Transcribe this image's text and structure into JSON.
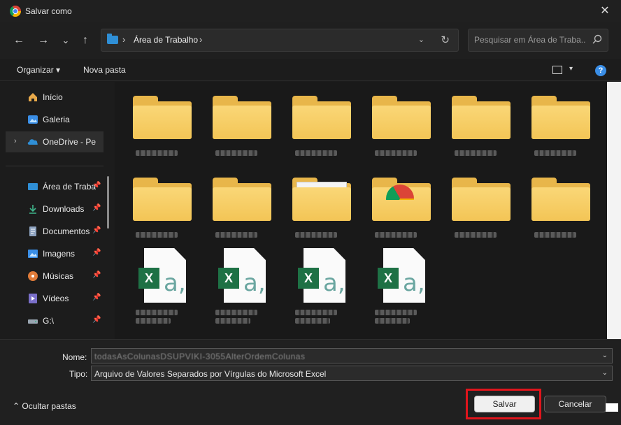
{
  "window": {
    "title": "Salvar como",
    "close": "✕"
  },
  "nav": {
    "back": "←",
    "forward": "→",
    "recent": "⌄",
    "up": "↑",
    "address": {
      "path": "Área de Trabalho",
      "sep": "›",
      "dropdown": "⌄",
      "refresh": "↻"
    },
    "search": {
      "placeholder": "Pesquisar em Área de Traba..."
    }
  },
  "toolbar": {
    "organize": "Organizar ▾",
    "new_folder": "Nova pasta",
    "view_dd": "▾",
    "help": "?"
  },
  "sidebar": {
    "items": [
      {
        "label": "Início",
        "icon": "home-icon"
      },
      {
        "label": "Galeria",
        "icon": "gallery-icon"
      },
      {
        "label": "OneDrive - Pessoal",
        "icon": "onedrive-icon",
        "chevron": "›",
        "selected": true
      },
      {
        "label": "Área de Trabalho",
        "icon": "desktop-icon",
        "pin": "📌"
      },
      {
        "label": "Downloads",
        "icon": "download-icon",
        "pin": "📌"
      },
      {
        "label": "Documentos",
        "icon": "documents-icon",
        "pin": "📌"
      },
      {
        "label": "Imagens",
        "icon": "pictures-icon",
        "pin": "📌"
      },
      {
        "label": "Músicas",
        "icon": "music-icon",
        "pin": "📌"
      },
      {
        "label": "Vídeos",
        "icon": "video-icon",
        "pin": "📌"
      },
      {
        "label": "G:\\",
        "icon": "drive-icon",
        "pin": "📌"
      }
    ]
  },
  "content": {
    "files": [
      {
        "type": "folder"
      },
      {
        "type": "folder"
      },
      {
        "type": "folder"
      },
      {
        "type": "folder"
      },
      {
        "type": "folder"
      },
      {
        "type": "folder"
      },
      {
        "type": "folder"
      },
      {
        "type": "folder"
      },
      {
        "type": "folder-preview"
      },
      {
        "type": "folder-chrome"
      },
      {
        "type": "folder"
      },
      {
        "type": "folder"
      },
      {
        "type": "xlsx",
        "x_glyph": "X",
        "a_glyph": "a,"
      },
      {
        "type": "xlsx",
        "x_glyph": "X",
        "a_glyph": "a,"
      },
      {
        "type": "xlsx",
        "x_glyph": "X",
        "a_glyph": "a,"
      },
      {
        "type": "xlsx",
        "x_glyph": "X",
        "a_glyph": "a,"
      }
    ]
  },
  "form": {
    "name_label": "Nome:",
    "name_value": "todasAsColunasDSUPVIKI-3055AlterOrdemColunas",
    "type_label": "Tipo:",
    "type_value": "Arquivo de Valores Separados por Vírgulas do Microsoft Excel",
    "dropdown": "⌄",
    "hide_folders": "⌃  Ocultar pastas",
    "save": "Salvar",
    "cancel": "Cancelar"
  },
  "colors": {
    "accent": "#3a8ee6",
    "highlight": "#e0151c",
    "excel_green": "#1e7145",
    "folder_yellow": "#f3c556"
  }
}
